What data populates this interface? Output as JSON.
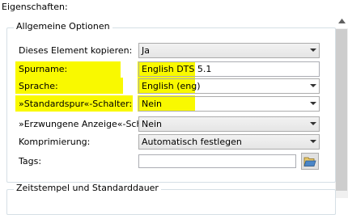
{
  "panel": {
    "title": "Eigenschaften:"
  },
  "general_group": {
    "title": "Allgemeine Optionen",
    "rows": [
      {
        "label": "Dieses Element kopieren:",
        "value": "Ja",
        "type": "dropdown"
      },
      {
        "label": "Spurname:",
        "value": "English DTS 5.1",
        "type": "text"
      },
      {
        "label": "Sprache:",
        "value": "English (eng)",
        "type": "dropdown"
      },
      {
        "label": "»Standardspur«-Schalter:",
        "value": "Nein",
        "type": "dropdown"
      },
      {
        "label": "»Erzwungene Anzeige«-Schalter:",
        "value": "Nein",
        "type": "dropdown"
      },
      {
        "label": "Komprimierung:",
        "value": "Automatisch festlegen",
        "type": "dropdown"
      },
      {
        "label": "Tags:",
        "value": "",
        "type": "file"
      }
    ]
  },
  "timestamp_group": {
    "title": "Zeitstempel und Standarddauer"
  },
  "highlight_color": "#f9f900",
  "icons": {
    "browse": "folder-open-icon",
    "dropdown": "chevron-down-icon",
    "scroll": "scroll-up-arrow-icon"
  }
}
